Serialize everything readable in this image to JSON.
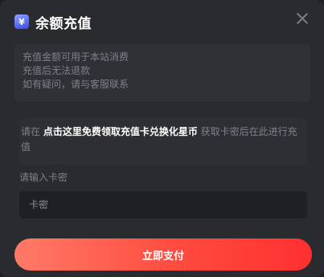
{
  "dialog": {
    "title": "余额充值",
    "icon": "yen-coin-icon",
    "close_icon": "close-icon"
  },
  "notice": {
    "lines": [
      "充值金额可用于本站消费",
      "充值后无法退款",
      "如有疑问，请与客服联系"
    ]
  },
  "redeem": {
    "prefix": "请在 ",
    "link_text": "点击这里免费领取充值卡兑换化星币",
    "suffix": " 获取卡密后在此进行充值"
  },
  "card_field": {
    "label": "请输入卡密",
    "placeholder": "卡密",
    "value": ""
  },
  "pay_button": {
    "label": "立即支付"
  },
  "colors": {
    "accent_start": "#ff7a67",
    "accent_end": "#ff3030",
    "icon_blue": "#5b6bff"
  }
}
